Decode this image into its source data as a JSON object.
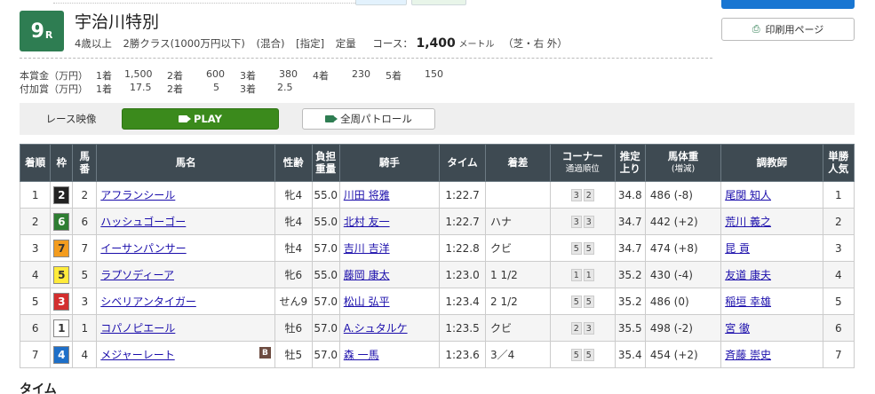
{
  "race": {
    "number": "9",
    "r_suffix": "R",
    "title": "宇治川特別",
    "conditions": [
      "4歳以上",
      "2勝クラス(1000万円以下)",
      "(混合)",
      "[指定]",
      "定量"
    ],
    "course_label": "コース：",
    "distance": "1,400",
    "distance_unit": "メートル",
    "surface": "（芝・右 外）"
  },
  "print_label": "印刷用ページ",
  "prize": {
    "main_label": "本賞金（万円）",
    "main": [
      {
        "place": "1着",
        "value": "1,500"
      },
      {
        "place": "2着",
        "value": "600"
      },
      {
        "place": "3着",
        "value": "380"
      },
      {
        "place": "4着",
        "value": "230"
      },
      {
        "place": "5着",
        "value": "150"
      }
    ],
    "extra_label": "付加賞（万円）",
    "extra": [
      {
        "place": "1着",
        "value": "17.5"
      },
      {
        "place": "2着",
        "value": "5"
      },
      {
        "place": "3着",
        "value": "2.5"
      }
    ]
  },
  "video": {
    "race_video": "レース映像",
    "play": "PLAY",
    "patrol": "全周パトロール"
  },
  "table": {
    "headers": {
      "rank": "着順",
      "waku": "枠",
      "umaban_1": "馬",
      "umaban_2": "番",
      "horse": "馬名",
      "sex_age": "性齢",
      "weight_1": "負担",
      "weight_2": "重量",
      "jockey": "騎手",
      "time": "タイム",
      "margin": "着差",
      "corner_1": "コーナー",
      "corner_2": "通過順位",
      "last3f_1": "推定",
      "last3f_2": "上り",
      "body_1": "馬体重",
      "body_2": "(増減)",
      "trainer": "調教師",
      "pop_1": "単勝",
      "pop_2": "人気"
    },
    "rows": [
      {
        "rank": "1",
        "waku": "2",
        "waku_bg": "#222222",
        "waku_fg": "#ffffff",
        "umaban": "2",
        "horse": "アフランシール",
        "blinker": "",
        "sex_age": "牝4",
        "weight": "55.0",
        "jockey": "川田 将雅",
        "time": "1:22.7",
        "margin": "",
        "corner": [
          "3",
          "2"
        ],
        "last3f": "34.8",
        "body": "486 (-8)",
        "trainer": "尾関 知人",
        "pop": "1"
      },
      {
        "rank": "2",
        "waku": "6",
        "waku_bg": "#2e7d32",
        "waku_fg": "#ffffff",
        "umaban": "6",
        "horse": "ハッシュゴーゴー",
        "blinker": "",
        "sex_age": "牝4",
        "weight": "55.0",
        "jockey": "北村 友一",
        "time": "1:22.7",
        "margin": "ハナ",
        "corner": [
          "3",
          "3"
        ],
        "last3f": "34.7",
        "body": "442 (+2)",
        "trainer": "荒川 義之",
        "pop": "2"
      },
      {
        "rank": "3",
        "waku": "7",
        "waku_bg": "#f39c1e",
        "waku_fg": "#333333",
        "umaban": "7",
        "horse": "イーサンパンサー",
        "blinker": "",
        "sex_age": "牡4",
        "weight": "57.0",
        "jockey": "吉川 吉洋",
        "time": "1:22.8",
        "margin": "クビ",
        "corner": [
          "5",
          "5"
        ],
        "last3f": "34.7",
        "body": "474 (+8)",
        "trainer": "昆 貢",
        "pop": "3"
      },
      {
        "rank": "4",
        "waku": "5",
        "waku_bg": "#ffeb3b",
        "waku_fg": "#333333",
        "umaban": "5",
        "horse": "ラプソディーア",
        "blinker": "",
        "sex_age": "牝6",
        "weight": "55.0",
        "jockey": "藤岡 康太",
        "time": "1:23.0",
        "margin": "1 1/2",
        "corner": [
          "1",
          "1"
        ],
        "last3f": "35.2",
        "body": "430 (-4)",
        "trainer": "友道 康夫",
        "pop": "4"
      },
      {
        "rank": "5",
        "waku": "3",
        "waku_bg": "#d32f2f",
        "waku_fg": "#ffffff",
        "umaban": "3",
        "horse": "シベリアンタイガー",
        "blinker": "",
        "sex_age": "せん9",
        "weight": "57.0",
        "jockey": "松山 弘平",
        "time": "1:23.4",
        "margin": "2 1/2",
        "corner": [
          "5",
          "5"
        ],
        "last3f": "35.2",
        "body": "486 (0)",
        "trainer": "稲垣 幸雄",
        "pop": "5"
      },
      {
        "rank": "6",
        "waku": "1",
        "waku_bg": "#ffffff",
        "waku_fg": "#333333",
        "umaban": "1",
        "horse": "コパノピエール",
        "blinker": "",
        "sex_age": "牡6",
        "weight": "57.0",
        "jockey": "A.シュタルケ",
        "time": "1:23.5",
        "margin": "クビ",
        "corner": [
          "2",
          "3"
        ],
        "last3f": "35.5",
        "body": "498 (-2)",
        "trainer": "宮 徹",
        "pop": "6"
      },
      {
        "rank": "7",
        "waku": "4",
        "waku_bg": "#1e6fc8",
        "waku_fg": "#ffffff",
        "umaban": "4",
        "horse": "メジャーレート",
        "blinker": "B",
        "sex_age": "牡5",
        "weight": "57.0",
        "jockey": "森 一馬",
        "time": "1:23.6",
        "margin": "3／4",
        "corner": [
          "5",
          "5"
        ],
        "last3f": "35.4",
        "body": "454 (+2)",
        "trainer": "斉藤 崇史",
        "pop": "7"
      }
    ]
  },
  "time_section_heading": "タイム",
  "colors": {
    "badge_green": "#2e7d52",
    "play_green": "#3b8a1c",
    "header_bg": "#3e4a52",
    "link": "#1a0dab"
  }
}
